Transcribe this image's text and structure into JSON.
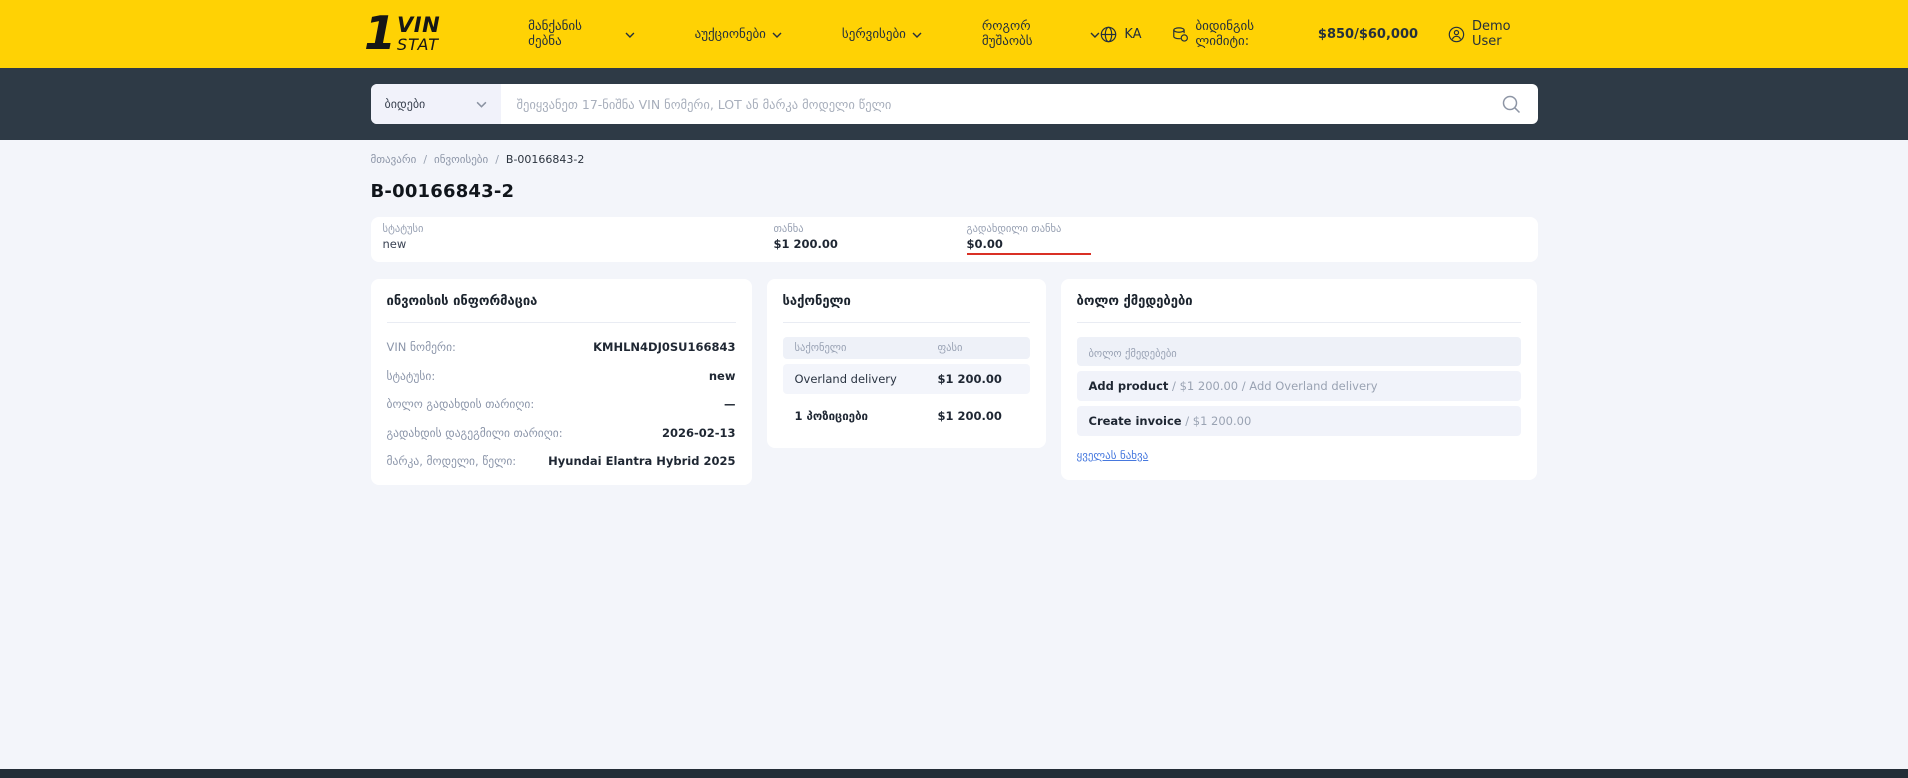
{
  "brand": {
    "one": "1",
    "vin": "VIN",
    "stat": "STAT"
  },
  "nav": {
    "items": [
      {
        "label": "მანქანის ძებნა"
      },
      {
        "label": "აუქციონები"
      },
      {
        "label": "სერვისები"
      },
      {
        "label": "როგორ მუშაობს"
      }
    ]
  },
  "header_right": {
    "lang": "KA",
    "limit_label": "ბიდინგის ლიმიტი:",
    "limit_value": "$850/$60,000",
    "user": "Demo User"
  },
  "search": {
    "category": "ბიდები",
    "placeholder": "შეიყვანეთ 17-ნიშნა VIN ნომერი, LOT ან მარკა მოდელი წელი"
  },
  "breadcrumb": {
    "items": [
      "მთავარი",
      "ინვოისები",
      "B-00166843-2"
    ],
    "separator": "/"
  },
  "page": {
    "title": "B-00166843-2"
  },
  "summary": {
    "status_label": "სტატუსი",
    "status_value": "new",
    "amount_label": "თანხა",
    "amount_value": "$1 200.00",
    "paid_label": "გადახდილი თანხა",
    "paid_value": "$0.00"
  },
  "invoice_info": {
    "title": "ინვოისის ინფორმაცია",
    "rows": [
      {
        "label": "VIN ნომერი:",
        "value": "KMHLN4DJ0SU166843"
      },
      {
        "label": "სტატუსი:",
        "value": "new"
      },
      {
        "label": "ბოლო გადახდის თარიღი:",
        "value": "—"
      },
      {
        "label": "გადახდის დაგეგმილი თარიღი:",
        "value": "2026-02-13"
      },
      {
        "label": "მარკა, მოდელი, წელი:",
        "value": "Hyundai Elantra Hybrid 2025"
      }
    ]
  },
  "goods": {
    "title": "საქონელი",
    "col_product": "საქონელი",
    "col_price": "ფასი",
    "rows": [
      {
        "name": "Overland delivery",
        "price": "$1 200.00"
      }
    ],
    "total_name": "1 პოზიციები",
    "total_price": "$1 200.00"
  },
  "actions": {
    "title": "ბოლო ქმედებები",
    "col_header": "ბოლო ქმედებები",
    "rows": [
      {
        "bold": "Add product",
        "rest": " / $1 200.00 / Add Overland delivery"
      },
      {
        "bold": "Create invoice",
        "rest": " / $1 200.00"
      }
    ],
    "view_all": "ყველას ნახვა"
  },
  "icons": {
    "chevron": "chevron-down-icon",
    "globe": "globe-icon",
    "coins": "coins-icon",
    "user": "user-icon",
    "search": "search-icon"
  },
  "colors": {
    "brand_yellow": "#FFD204",
    "header_dark": "#2E3A46",
    "page_bg": "#F3F5FA",
    "accent_red": "#D93025",
    "link_blue": "#4678DE",
    "label_gray": "#98A1B3"
  }
}
